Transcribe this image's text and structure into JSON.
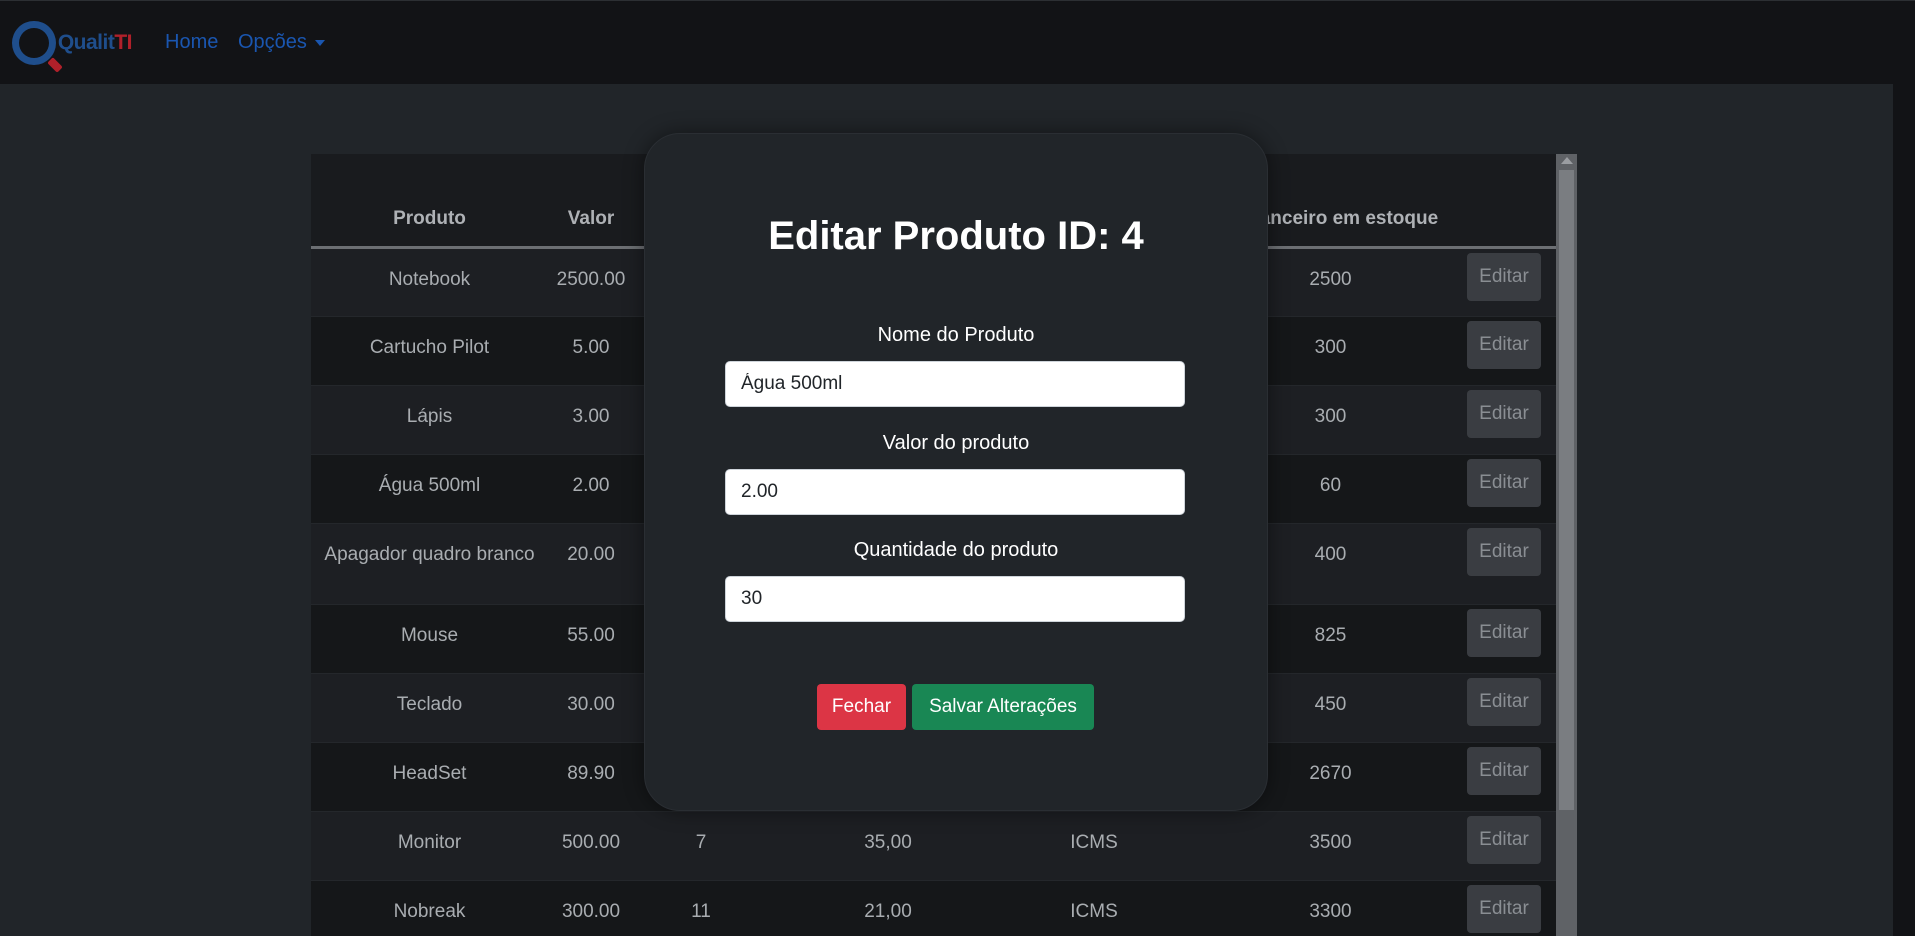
{
  "navbar": {
    "logo_text_a": "Qualit",
    "logo_text_b": "TI",
    "home": "Home",
    "opcoes": "Opções"
  },
  "table": {
    "headers": [
      "Produto",
      "Valor",
      "",
      "",
      "",
      "r financeiro em estoque",
      ""
    ],
    "rows": [
      {
        "produto": "Notebook",
        "valor": "2500.00",
        "qtd": "",
        "c4": "",
        "c5": "",
        "financeiro": "2500",
        "action": "Editar"
      },
      {
        "produto": "Cartucho Pilot",
        "valor": "5.00",
        "qtd": "",
        "c4": "",
        "c5": "",
        "financeiro": "300",
        "action": "Editar"
      },
      {
        "produto": "Lápis",
        "valor": "3.00",
        "qtd": "",
        "c4": "",
        "c5": "",
        "financeiro": "300",
        "action": "Editar"
      },
      {
        "produto": "Água 500ml",
        "valor": "2.00",
        "qtd": "",
        "c4": "",
        "c5": "",
        "financeiro": "60",
        "action": "Editar"
      },
      {
        "produto": "Apagador quadro branco",
        "valor": "20.00",
        "qtd": "",
        "c4": "",
        "c5": "",
        "financeiro": "400",
        "action": "Editar"
      },
      {
        "produto": "Mouse",
        "valor": "55.00",
        "qtd": "",
        "c4": "",
        "c5": "",
        "financeiro": "825",
        "action": "Editar"
      },
      {
        "produto": "Teclado",
        "valor": "30.00",
        "qtd": "",
        "c4": "",
        "c5": "",
        "financeiro": "450",
        "action": "Editar"
      },
      {
        "produto": "HeadSet",
        "valor": "89.90",
        "qtd": "",
        "c4": "",
        "c5": "",
        "financeiro": "2670",
        "action": "Editar"
      },
      {
        "produto": "Monitor",
        "valor": "500.00",
        "qtd": "7",
        "c4": "35,00",
        "c5": "ICMS",
        "financeiro": "3500",
        "action": "Editar"
      },
      {
        "produto": "Nobreak",
        "valor": "300.00",
        "qtd": "11",
        "c4": "21,00",
        "c5": "ICMS",
        "financeiro": "3300",
        "action": "Editar"
      }
    ]
  },
  "modal": {
    "title": "Editar Produto ID: 4",
    "name_label": "Nome do Produto",
    "name_value": "Água 500ml",
    "price_label": "Valor do produto",
    "price_value": "2.00",
    "qty_label": "Quantidade do produto",
    "qty_value": "30",
    "close_button": "Fechar",
    "save_button": "Salvar Alterações"
  },
  "colors": {
    "danger": "#dc3545",
    "success": "#198754",
    "brand_blue": "#1f4e8c",
    "brand_red": "#b0202a"
  }
}
